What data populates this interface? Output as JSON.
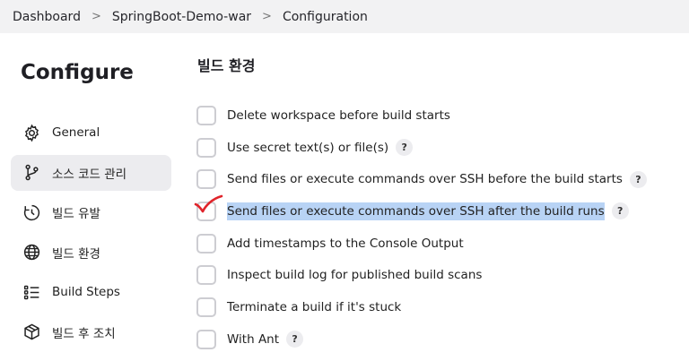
{
  "breadcrumb": {
    "items": [
      "Dashboard",
      "SpringBoot-Demo-war",
      "Configuration"
    ],
    "separator": ">"
  },
  "sidebar": {
    "title": "Configure",
    "items": [
      {
        "label": "General",
        "icon": "gear-icon"
      },
      {
        "label": "소스 코드 관리",
        "icon": "branch-icon",
        "active": true
      },
      {
        "label": "빌드 유발",
        "icon": "clock-icon"
      },
      {
        "label": "빌드 환경",
        "icon": "globe-icon"
      },
      {
        "label": "Build Steps",
        "icon": "list-icon"
      },
      {
        "label": "빌드 후 조치",
        "icon": "package-icon"
      }
    ]
  },
  "main": {
    "section_title": "빌드 환경",
    "options": [
      {
        "label": "Delete workspace before build starts",
        "help": false
      },
      {
        "label": "Use secret text(s) or file(s)",
        "help": true
      },
      {
        "label": "Send files or execute commands over SSH before the build starts",
        "help": true
      },
      {
        "label": "Send files or execute commands over SSH after the build runs",
        "help": true,
        "selected": true,
        "annotated": true
      },
      {
        "label": "Add timestamps to the Console Output",
        "help": false
      },
      {
        "label": "Inspect build log for published build scans",
        "help": false
      },
      {
        "label": "Terminate a build if it's stuck",
        "help": false
      },
      {
        "label": "With Ant",
        "help": true
      }
    ],
    "help_glyph": "?"
  },
  "colors": {
    "breadcrumb_bg": "#f2f2f3",
    "active_nav_bg": "#ececef",
    "selection": "#b8d3f5",
    "annotation": "#e0242b"
  }
}
